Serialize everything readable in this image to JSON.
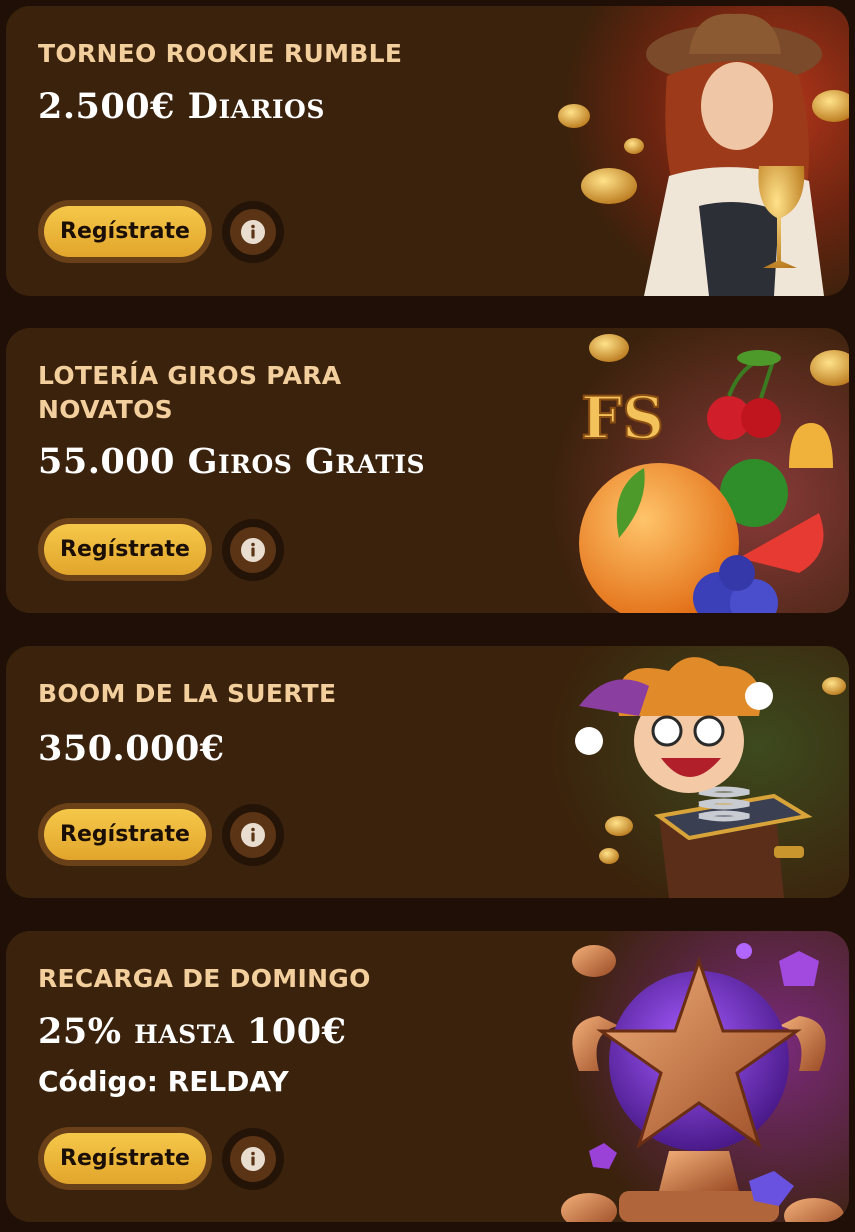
{
  "promotions": [
    {
      "title": "TORNEO ROOKIE RUMBLE",
      "prize": "2.500€ Diarios",
      "code": "",
      "register_label": "Regístrate",
      "illustration": "cowgirl-with-trophy"
    },
    {
      "title": "LOTERÍA GIROS PARA\nNOVATOS",
      "prize": "55.000 Giros Gratis",
      "code": "",
      "register_label": "Regístrate",
      "illustration": "fruit-slot-symbols",
      "illustration_text": "FS"
    },
    {
      "title": "BOOM DE LA SUERTE",
      "prize": "350.000€",
      "code": "",
      "register_label": "Regístrate",
      "illustration": "jester-in-the-box"
    },
    {
      "title": "RECARGA DE DOMINGO",
      "prize": "25% hasta 100€",
      "code": "Código: RELDAY",
      "register_label": "Regístrate",
      "illustration": "star-trophy-with-gems"
    }
  ],
  "colors": {
    "page_bg": "#1f0f06",
    "card_bg": "#3b220c",
    "title": "#f3cf9d",
    "prize": "#ffffff",
    "button_gold": "#f5c84a",
    "button_text": "#1b0f05"
  },
  "icons": {
    "info": "info-icon"
  }
}
